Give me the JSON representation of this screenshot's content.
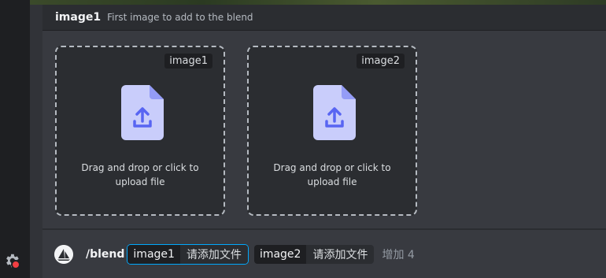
{
  "option": {
    "name": "image1",
    "description": "First image to add to the blend"
  },
  "dropzones": [
    {
      "tag": "image1",
      "line1": "Drag and drop or click to",
      "line2": "upload file"
    },
    {
      "tag": "image2",
      "line1": "Drag and drop or click to",
      "line2": "upload file"
    }
  ],
  "command": {
    "name": "/blend",
    "options": [
      {
        "key": "image1",
        "value": "请添加文件"
      },
      {
        "key": "image2",
        "value": "请添加文件"
      }
    ],
    "more": "增加 4"
  },
  "icons": {
    "settings": "gear-icon",
    "upload": "file-upload-icon",
    "bot": "bot-avatar-icon"
  },
  "colors": {
    "accent": "#00a8fc",
    "upload_icon": "#c9cdfb",
    "upload_arrow": "#5865f2",
    "notification": "#f23f43"
  }
}
